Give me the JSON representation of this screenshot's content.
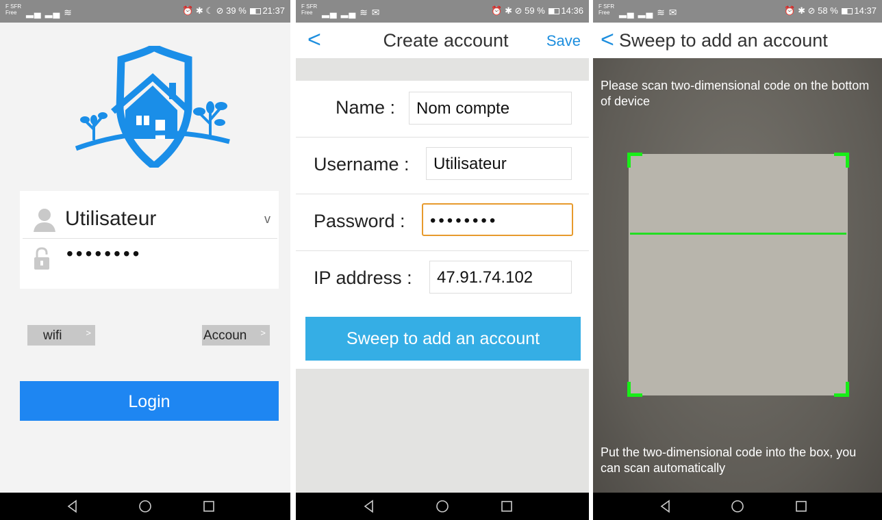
{
  "screens": [
    {
      "status": {
        "carrier_line1": "F SFR",
        "carrier_line2": "Free",
        "right": "⏰ ✱ ☾ ⊘ 39 %",
        "time": "21:37"
      },
      "login": {
        "username": "Utilisateur",
        "password": "••••••••",
        "wifi_label": "wifi",
        "account_label": "Accoun",
        "login_label": "Login",
        "chevron": "v",
        "arrow": ">"
      }
    },
    {
      "status": {
        "carrier_line1": "F SFR",
        "carrier_line2": "Free",
        "right": "⏰ ✱ ⊘ 59 %",
        "time": "14:36"
      },
      "header": {
        "back": "<",
        "title": "Create account",
        "save": "Save"
      },
      "form": {
        "name_label": "Name :",
        "name_value": "Nom compte",
        "username_label": "Username :",
        "username_value": "Utilisateur",
        "password_label": "Password :",
        "password_value": "••••••••",
        "ip_label": "IP address :",
        "ip_value": "47.91.74.102"
      },
      "sweep_label": "Sweep to add an account"
    },
    {
      "status": {
        "carrier_line1": "F SFR",
        "carrier_line2": "Free",
        "right": "⏰ ✱ ⊘ 58 %",
        "time": "14:37"
      },
      "header": {
        "back": "<",
        "title": "Sweep to add an account"
      },
      "scan": {
        "top_text": "Please scan two-dimensional code on the bottom of device",
        "bottom_text": "Put the two-dimensional code into the box, you can scan automatically"
      }
    }
  ],
  "icons": [
    "signal-icon",
    "wifi-icon",
    "battery-icon",
    "back-triangle-icon",
    "home-circle-icon",
    "recent-square-icon",
    "user-icon",
    "lock-icon",
    "shield-house-logo-icon"
  ],
  "colors": {
    "login_blue": "#1e86f2",
    "sweep_blue": "#35aee5",
    "ios_blue": "#1d8ede",
    "focus_orange": "#e79a2c",
    "scan_green": "#18ee18"
  }
}
